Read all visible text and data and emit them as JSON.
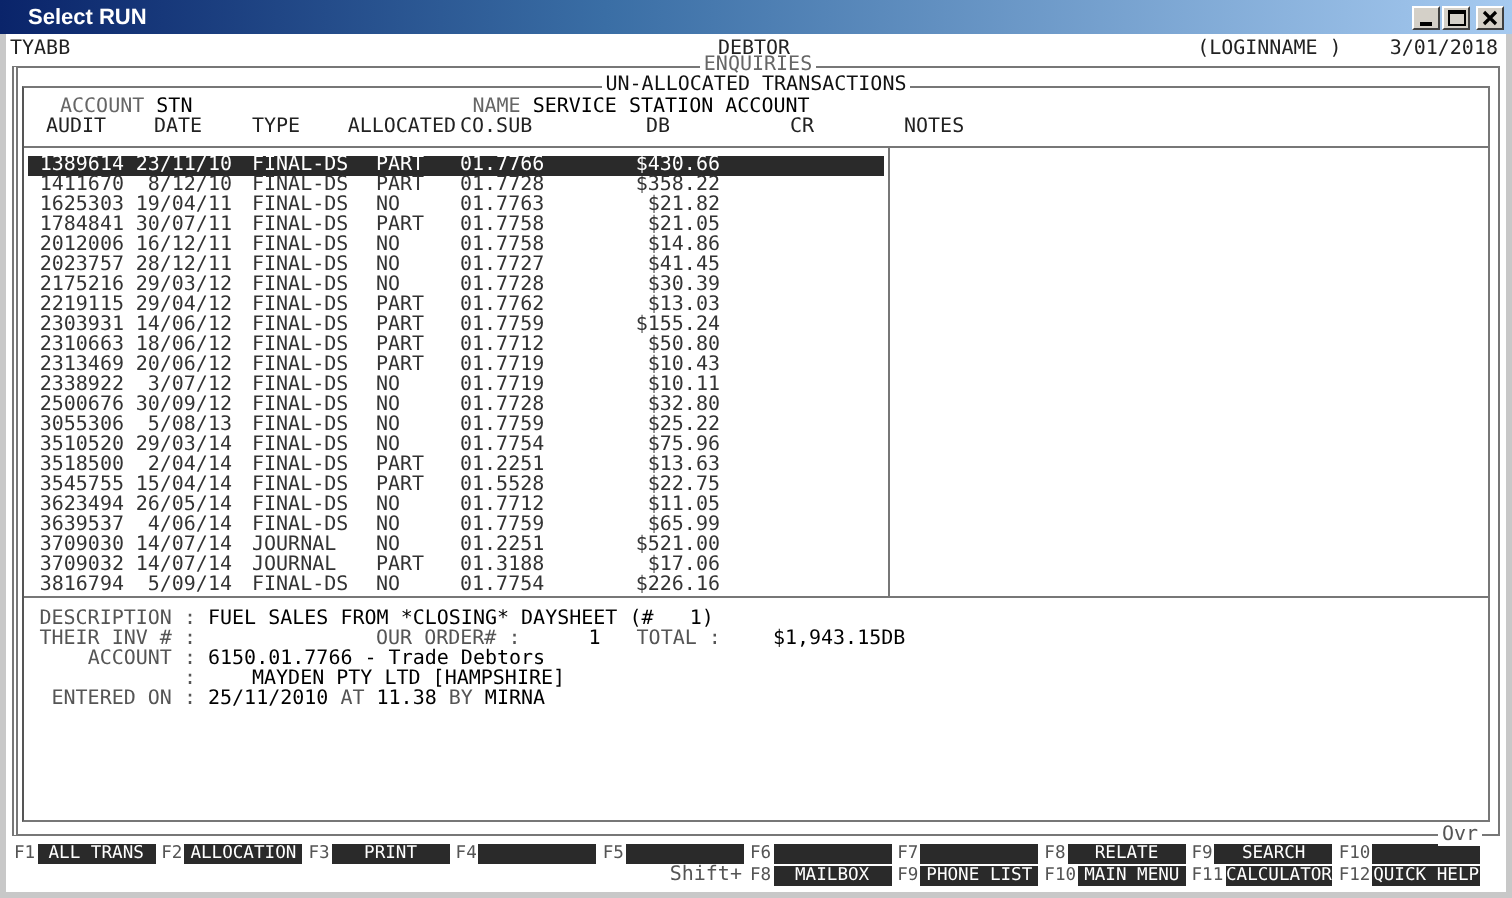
{
  "window": {
    "title": "Select RUN"
  },
  "header": {
    "company": "TYABB",
    "module": "DEBTOR",
    "login": "(LOGINNAME )",
    "date": "3/01/2018"
  },
  "screen_title": "ENQUIRIES",
  "panel_title": "UN-ALLOCATED TRANSACTIONS",
  "account": {
    "label": "ACCOUNT",
    "value": "STN",
    "name_label": "NAME",
    "name_value": "SERVICE STATION ACCOUNT"
  },
  "table": {
    "columns": [
      "AUDIT",
      "DATE",
      "TYPE",
      "ALLOCATED",
      "CO.SUB",
      "DB",
      "CR"
    ],
    "notes_heading": "NOTES",
    "rows": [
      {
        "audit": "1389614",
        "date": "23/11/10",
        "type": "FINAL-DS",
        "allocated": "PART",
        "cosub": "01.7766",
        "db": "$430.66",
        "selected": true
      },
      {
        "audit": "1411670",
        "date": "8/12/10",
        "type": "FINAL-DS",
        "allocated": "PART",
        "cosub": "01.7728",
        "db": "$358.22",
        "selected": false
      },
      {
        "audit": "1625303",
        "date": "19/04/11",
        "type": "FINAL-DS",
        "allocated": "NO",
        "cosub": "01.7763",
        "db": "$21.82",
        "selected": false
      },
      {
        "audit": "1784841",
        "date": "30/07/11",
        "type": "FINAL-DS",
        "allocated": "PART",
        "cosub": "01.7758",
        "db": "$21.05",
        "selected": false
      },
      {
        "audit": "2012006",
        "date": "16/12/11",
        "type": "FINAL-DS",
        "allocated": "NO",
        "cosub": "01.7758",
        "db": "$14.86",
        "selected": false
      },
      {
        "audit": "2023757",
        "date": "28/12/11",
        "type": "FINAL-DS",
        "allocated": "NO",
        "cosub": "01.7727",
        "db": "$41.45",
        "selected": false
      },
      {
        "audit": "2175216",
        "date": "29/03/12",
        "type": "FINAL-DS",
        "allocated": "NO",
        "cosub": "01.7728",
        "db": "$30.39",
        "selected": false
      },
      {
        "audit": "2219115",
        "date": "29/04/12",
        "type": "FINAL-DS",
        "allocated": "PART",
        "cosub": "01.7762",
        "db": "$13.03",
        "selected": false
      },
      {
        "audit": "2303931",
        "date": "14/06/12",
        "type": "FINAL-DS",
        "allocated": "PART",
        "cosub": "01.7759",
        "db": "$155.24",
        "selected": false
      },
      {
        "audit": "2310663",
        "date": "18/06/12",
        "type": "FINAL-DS",
        "allocated": "PART",
        "cosub": "01.7712",
        "db": "$50.80",
        "selected": false
      },
      {
        "audit": "2313469",
        "date": "20/06/12",
        "type": "FINAL-DS",
        "allocated": "PART",
        "cosub": "01.7719",
        "db": "$10.43",
        "selected": false
      },
      {
        "audit": "2338922",
        "date": "3/07/12",
        "type": "FINAL-DS",
        "allocated": "NO",
        "cosub": "01.7719",
        "db": "$10.11",
        "selected": false
      },
      {
        "audit": "2500676",
        "date": "30/09/12",
        "type": "FINAL-DS",
        "allocated": "NO",
        "cosub": "01.7728",
        "db": "$32.80",
        "selected": false
      },
      {
        "audit": "3055306",
        "date": "5/08/13",
        "type": "FINAL-DS",
        "allocated": "NO",
        "cosub": "01.7759",
        "db": "$25.22",
        "selected": false
      },
      {
        "audit": "3510520",
        "date": "29/03/14",
        "type": "FINAL-DS",
        "allocated": "NO",
        "cosub": "01.7754",
        "db": "$75.96",
        "selected": false
      },
      {
        "audit": "3518500",
        "date": "2/04/14",
        "type": "FINAL-DS",
        "allocated": "PART",
        "cosub": "01.2251",
        "db": "$13.63",
        "selected": false
      },
      {
        "audit": "3545755",
        "date": "15/04/14",
        "type": "FINAL-DS",
        "allocated": "PART",
        "cosub": "01.5528",
        "db": "$22.75",
        "selected": false
      },
      {
        "audit": "3623494",
        "date": "26/05/14",
        "type": "FINAL-DS",
        "allocated": "NO",
        "cosub": "01.7712",
        "db": "$11.05",
        "selected": false
      },
      {
        "audit": "3639537",
        "date": "4/06/14",
        "type": "FINAL-DS",
        "allocated": "NO",
        "cosub": "01.7759",
        "db": "$65.99",
        "selected": false
      },
      {
        "audit": "3709030",
        "date": "14/07/14",
        "type": "JOURNAL",
        "allocated": "NO",
        "cosub": "01.2251",
        "db": "$521.00",
        "selected": false
      },
      {
        "audit": "3709032",
        "date": "14/07/14",
        "type": "JOURNAL",
        "allocated": "PART",
        "cosub": "01.3188",
        "db": "$17.06",
        "selected": false
      },
      {
        "audit": "3816794",
        "date": "5/09/14",
        "type": "FINAL-DS",
        "allocated": "NO",
        "cosub": "01.7754",
        "db": "$226.16",
        "selected": false
      }
    ]
  },
  "detail": {
    "description": {
      "label": "DESCRIPTION :",
      "value": "FUEL SALES FROM *CLOSING* DAYSHEET (#   1)"
    },
    "their_inv": {
      "label": "THEIR INV # :"
    },
    "our_order": {
      "label": "OUR ORDER# :",
      "value": "1"
    },
    "total": {
      "label": "TOTAL :",
      "value": "$1,943.15DB"
    },
    "account": {
      "label": "ACCOUNT :",
      "value": "6150.01.7766 - Trade Debtors"
    },
    "account_name": {
      "label": ":",
      "value": "MAYDEN PTY LTD [HAMPSHIRE]"
    },
    "entered": {
      "label": "ENTERED ON :",
      "date": "25/11/2010",
      "at_label": "AT",
      "time": "11.38",
      "by_label": "BY",
      "user": "MIRNA"
    }
  },
  "mode_indicator": "Ovr",
  "function_keys": [
    {
      "key": "F1",
      "label": "ALL TRANS"
    },
    {
      "key": "F2",
      "label": "ALLOCATION"
    },
    {
      "key": "F3",
      "label": "PRINT"
    },
    {
      "key": "F4"
    },
    {
      "key": "F5"
    },
    {
      "key": "F6"
    },
    {
      "key": "F7"
    },
    {
      "key": "F8",
      "label": "RELATE"
    },
    {
      "key": "F9",
      "label": "SEARCH"
    },
    {
      "key": "F10"
    }
  ],
  "shift_keys": {
    "label": "Shift+",
    "keys": [
      {
        "key": "F8",
        "label": "MAILBOX"
      },
      {
        "key": "F9",
        "label": "PHONE LIST"
      },
      {
        "key": "F10",
        "label": "MAIN MENU"
      },
      {
        "key": "F11",
        "label": "CALCULATOR"
      },
      {
        "key": "F12",
        "label": "QUICK HELP"
      }
    ]
  }
}
